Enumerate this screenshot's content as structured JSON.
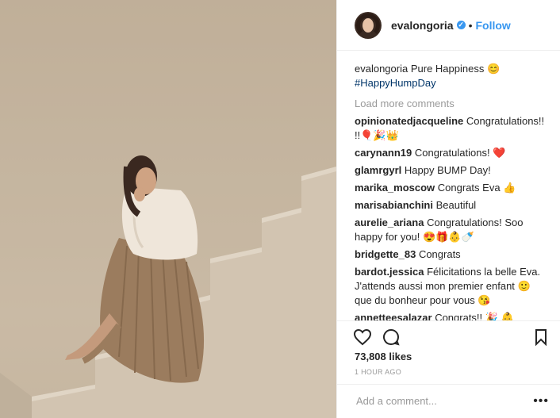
{
  "post": {
    "username": "evalongoria",
    "verified_glyph": "✓",
    "separator": "•",
    "follow_label": "Follow"
  },
  "caption": {
    "username": "evalongoria",
    "text": "Pure Happiness 😊",
    "hashtag": "#HappyHumpDay"
  },
  "load_more": "Load more comments",
  "comments": [
    {
      "user": "opinionatedjacqueline",
      "text": "Congratulations!! !!🎈🎉👑"
    },
    {
      "user": "carynann19",
      "text": "Congratulations! ❤️"
    },
    {
      "user": "glamrgyrl",
      "text": "Happy BUMP Day!"
    },
    {
      "user": "marika_moscow",
      "text": "Congrats Eva 👍"
    },
    {
      "user": "marisabianchini",
      "text": "Beautiful"
    },
    {
      "user": "aurelie_ariana",
      "text": "Congratulations! Soo happy for you! 😍🎁👶🍼"
    },
    {
      "user": "bridgette_83",
      "text": "Congrats"
    },
    {
      "user": "bardot.jessica",
      "text": "Félicitations la belle Eva. J'attends aussi mon premier enfant 🙂 que du bonheur pour vous 😘"
    },
    {
      "user": "annetteesalazar",
      "text": "Congrats!! 🎉 👶"
    }
  ],
  "likes": "73,808 likes",
  "time": "1 HOUR AGO",
  "add_comment_placeholder": "Add a comment...",
  "more_glyph": "•••",
  "icons": {
    "like": "heart-icon",
    "comment": "comment-bubble-icon",
    "save": "bookmark-icon"
  }
}
